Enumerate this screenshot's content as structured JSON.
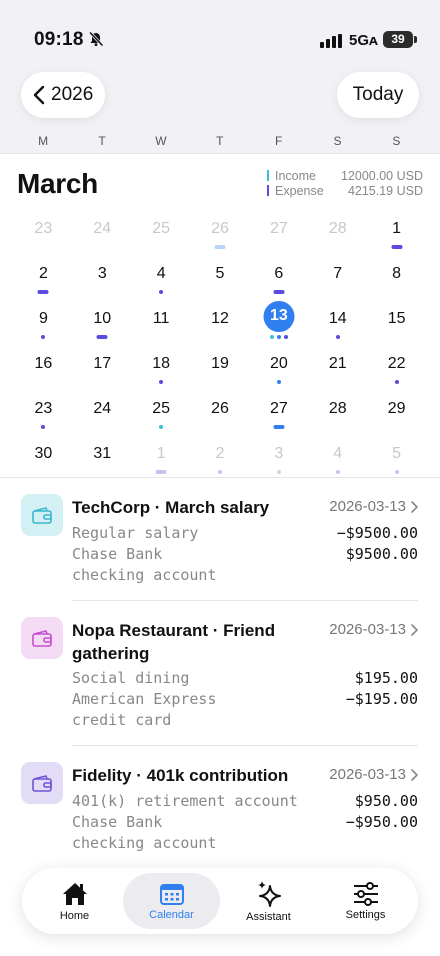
{
  "status_bar": {
    "time": "09:18",
    "network": "5Gᴀ",
    "battery": "39"
  },
  "header": {
    "back_label": "2026",
    "today_label": "Today",
    "weekdays": [
      "M",
      "T",
      "W",
      "T",
      "F",
      "S",
      "S"
    ]
  },
  "month": {
    "title": "March",
    "income_label": "Income",
    "income_value": "12000.00 USD",
    "expense_label": "Expense",
    "expense_value": "4215.19 USD"
  },
  "colors": {
    "accent": "#2f7ff0",
    "income": "#3cc0d8",
    "expense": "#5b4be0",
    "muted_mark": "#c7c3ef"
  },
  "calendar": {
    "selected": 13,
    "weeks": [
      [
        {
          "d": "23",
          "m": true
        },
        {
          "d": "24",
          "m": true
        },
        {
          "d": "25",
          "m": true
        },
        {
          "d": "26",
          "m": true,
          "mark": "dash",
          "c": "#b9d4f5"
        },
        {
          "d": "27",
          "m": true
        },
        {
          "d": "28",
          "m": true
        },
        {
          "d": "1",
          "mark": "dash",
          "c": "#5b4be0"
        }
      ],
      [
        {
          "d": "2",
          "mark": "dash",
          "c": "#5b4be0"
        },
        {
          "d": "3"
        },
        {
          "d": "4",
          "mark": "dot",
          "c": "#5b4be0"
        },
        {
          "d": "5"
        },
        {
          "d": "6",
          "mark": "dash",
          "c": "#5b4be0"
        },
        {
          "d": "7"
        },
        {
          "d": "8"
        }
      ],
      [
        {
          "d": "9",
          "mark": "dot",
          "c": "#5b4be0"
        },
        {
          "d": "10",
          "mark": "dash",
          "c": "#5b4be0"
        },
        {
          "d": "11"
        },
        {
          "d": "12"
        },
        {
          "d": "13",
          "sel": true,
          "mark": "dots3",
          "c": "#3cc0d8"
        },
        {
          "d": "14",
          "mark": "dot",
          "c": "#5b4be0"
        },
        {
          "d": "15"
        }
      ],
      [
        {
          "d": "16"
        },
        {
          "d": "17"
        },
        {
          "d": "18",
          "mark": "dot",
          "c": "#5b4be0"
        },
        {
          "d": "19"
        },
        {
          "d": "20",
          "mark": "dot",
          "c": "#2f7ff0"
        },
        {
          "d": "21"
        },
        {
          "d": "22",
          "mark": "dot",
          "c": "#5b4be0"
        }
      ],
      [
        {
          "d": "23",
          "mark": "dot",
          "c": "#5b4be0"
        },
        {
          "d": "24"
        },
        {
          "d": "25",
          "mark": "dot",
          "c": "#3cc0d8"
        },
        {
          "d": "26"
        },
        {
          "d": "27",
          "mark": "dash",
          "c": "#2f7ff0"
        },
        {
          "d": "28"
        },
        {
          "d": "29"
        }
      ],
      [
        {
          "d": "30"
        },
        {
          "d": "31"
        },
        {
          "d": "1",
          "m": true,
          "mark": "dash",
          "c": "#c7c3ef"
        },
        {
          "d": "2",
          "m": true,
          "mark": "dot",
          "c": "#c7c3ef"
        },
        {
          "d": "3",
          "m": true,
          "mark": "dot",
          "c": "#d4d4d8"
        },
        {
          "d": "4",
          "m": true,
          "mark": "dot",
          "c": "#c7c3ef"
        },
        {
          "d": "5",
          "m": true,
          "mark": "dot",
          "c": "#c7c3ef"
        }
      ]
    ]
  },
  "transactions": [
    {
      "title": "TechCorp · March salary",
      "date": "2026-03-13",
      "icon": "wallet-icon",
      "icon_bg": "#d3f1f4",
      "icon_color": "#3bb8cc",
      "lines": [
        {
          "label": "Regular salary",
          "amount": "−$9500.00"
        },
        {
          "label": "Chase Bank",
          "amount": "$9500.00"
        },
        {
          "label": "checking account",
          "amount": ""
        }
      ]
    },
    {
      "title": "Nopa Restaurant · Friend gathering",
      "date": "2026-03-13",
      "icon": "wallet-icon",
      "icon_bg": "#f4dcf5",
      "icon_color": "#c54fd1",
      "lines": [
        {
          "label": "Social dining",
          "amount": "$195.00"
        },
        {
          "label": "American Express",
          "amount": "−$195.00"
        },
        {
          "label": "credit card",
          "amount": ""
        }
      ]
    },
    {
      "title": "Fidelity · 401k contribution",
      "date": "2026-03-13",
      "icon": "wallet-icon",
      "icon_bg": "#e2dcf7",
      "icon_color": "#6c55d6",
      "lines": [
        {
          "label": "401(k) retirement account",
          "amount": "$950.00"
        },
        {
          "label": "Chase Bank",
          "amount": "−$950.00"
        },
        {
          "label": "checking account",
          "amount": ""
        }
      ]
    }
  ],
  "tabbar": {
    "home": "Home",
    "calendar": "Calendar",
    "assistant": "Assistant",
    "settings": "Settings"
  }
}
